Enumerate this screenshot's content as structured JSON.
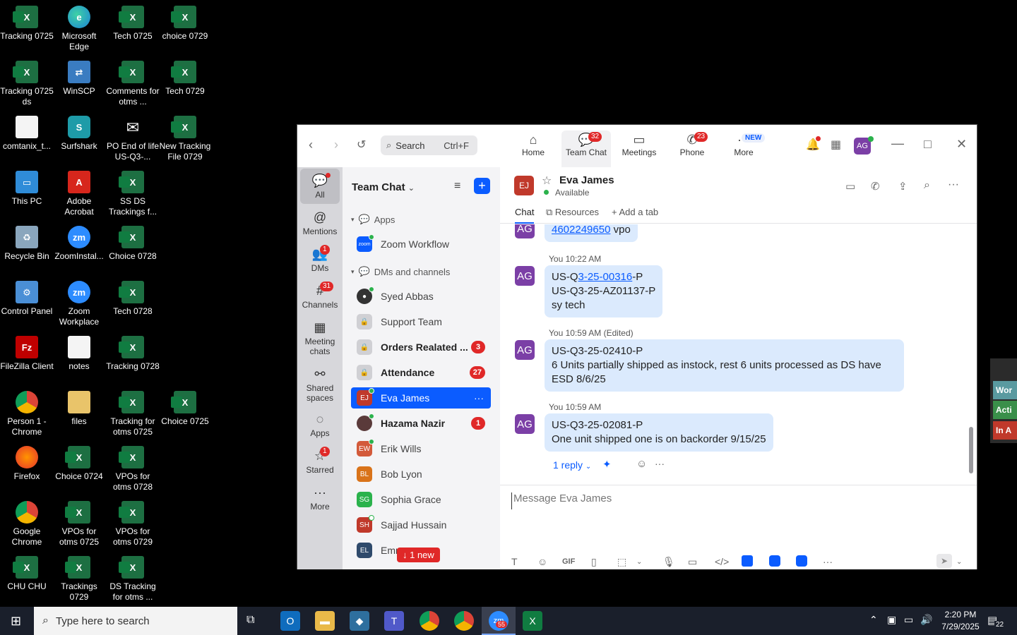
{
  "desktop": {
    "icons": [
      {
        "label": "Tracking 0725",
        "glyph": "X"
      },
      {
        "label": "Microsoft Edge",
        "glyph": "e"
      },
      {
        "label": "Tech 0725",
        "glyph": "X"
      },
      {
        "label": "choice 0729",
        "glyph": "X"
      },
      {
        "label": "Tracking 0725 ds",
        "glyph": "X"
      },
      {
        "label": "WinSCP",
        "glyph": "⇄"
      },
      {
        "label": "Comments for otms ...",
        "glyph": "X"
      },
      {
        "label": "Tech 0729",
        "glyph": "X"
      },
      {
        "label": "comtanix_t...",
        "glyph": ""
      },
      {
        "label": "Surfshark",
        "glyph": "S"
      },
      {
        "label": "PO End of life  US-Q3-...",
        "glyph": "✉"
      },
      {
        "label": "New Tracking File 0729",
        "glyph": "X"
      },
      {
        "label": "This PC",
        "glyph": "▭"
      },
      {
        "label": "Adobe Acrobat",
        "glyph": "A"
      },
      {
        "label": "SS DS Trackings f...",
        "glyph": "X"
      },
      {
        "label": "Recycle Bin",
        "glyph": "♻"
      },
      {
        "label": "ZoomInstal...",
        "glyph": "zm"
      },
      {
        "label": "Choice 0728",
        "glyph": "X"
      },
      {
        "label": "Control Panel",
        "glyph": "⚙"
      },
      {
        "label": "Zoom Workplace",
        "glyph": "zm"
      },
      {
        "label": "Tech 0728",
        "glyph": "X"
      },
      {
        "label": "FileZilla Client",
        "glyph": "Fz"
      },
      {
        "label": "notes",
        "glyph": ""
      },
      {
        "label": "Tracking 0728",
        "glyph": "X"
      },
      {
        "label": "Person 1 - Chrome",
        "glyph": ""
      },
      {
        "label": "files",
        "glyph": ""
      },
      {
        "label": "Tracking for otms 0725",
        "glyph": "X"
      },
      {
        "label": "Choice 0725",
        "glyph": "X"
      },
      {
        "label": "Firefox",
        "glyph": ""
      },
      {
        "label": "Choice 0724",
        "glyph": "X"
      },
      {
        "label": "VPOs for otms 0728",
        "glyph": "X"
      },
      {
        "label": "Google Chrome",
        "glyph": ""
      },
      {
        "label": "VPOs for otms 0725",
        "glyph": "X"
      },
      {
        "label": "VPOs for otms 0729",
        "glyph": "X"
      },
      {
        "label": "CHU CHU",
        "glyph": "X"
      },
      {
        "label": "Trackings 0729",
        "glyph": "X"
      },
      {
        "label": "DS Tracking for otms ...",
        "glyph": "X"
      }
    ]
  },
  "zoom": {
    "search": {
      "label": "Search",
      "shortcut": "Ctrl+F"
    },
    "nav": {
      "home": "Home",
      "team_chat": "Team Chat",
      "team_chat_badge": "32",
      "meetings": "Meetings",
      "phone": "Phone",
      "phone_badge": "23",
      "more": "More",
      "more_badge": "NEW"
    },
    "avatar_initials": "AG",
    "rail": {
      "all": "All",
      "mentions": "Mentions",
      "dms": "DMs",
      "dms_badge": "1",
      "channels": "Channels",
      "channels_badge": "31",
      "meeting_chats": "Meeting chats",
      "shared_spaces": "Shared spaces",
      "apps": "Apps",
      "starred": "Starred",
      "starred_badge": "1",
      "more": "More"
    },
    "sidebar": {
      "title": "Team Chat",
      "apps_section": "Apps",
      "zoom_workflow": "Zoom Workflow",
      "dms_section": "DMs and channels",
      "new_pill": "↓ 1 new",
      "items": [
        {
          "name": "Syed Abbas",
          "initials": "",
          "count": ""
        },
        {
          "name": "Support Team",
          "initials": "",
          "count": ""
        },
        {
          "name": "Orders Realated ...",
          "initials": "",
          "count": "3"
        },
        {
          "name": "Attendance",
          "initials": "",
          "count": "27"
        },
        {
          "name": "Eva James",
          "initials": "EJ",
          "count": ""
        },
        {
          "name": "Hazama Nazir",
          "initials": "",
          "count": "1"
        },
        {
          "name": "Erik Wills",
          "initials": "EW",
          "count": ""
        },
        {
          "name": "Bob Lyon",
          "initials": "BL",
          "count": ""
        },
        {
          "name": "Sophia Grace",
          "initials": "SG",
          "count": ""
        },
        {
          "name": "Sajjad Hussain",
          "initials": "SH",
          "count": ""
        },
        {
          "name": "Emm",
          "initials": "EL",
          "count": ""
        }
      ]
    },
    "chat": {
      "contact_initials": "EJ",
      "contact_name": "Eva James",
      "status": "Available",
      "tabs": {
        "chat": "Chat",
        "resources": "Resources",
        "add_tab": "Add a tab"
      },
      "messages": [
        {
          "meta": "",
          "initials": "AG",
          "lines": [
            "4602249650 vpo"
          ]
        },
        {
          "meta": "You 10:22 AM",
          "initials": "AG",
          "lines": [
            "US-Q3-25-00316-P",
            "US-Q3-25-AZ01137-P",
            "sy tech"
          ]
        },
        {
          "meta": "You 10:59 AM (Edited)",
          "initials": "AG",
          "lines": [
            "US-Q3-25-02410-P",
            "6 Units partially shipped as instock, rest 6 units processed as DS have ESD 8/6/25"
          ]
        },
        {
          "meta": "You 10:59 AM",
          "initials": "AG",
          "lines": [
            "US-Q3-25-02081-P",
            "One unit shipped one is on backorder 9/15/25"
          ]
        }
      ],
      "msg0_link": "4602249650",
      "msg0_rest": " vpo",
      "msg1_prefix": "US-Q",
      "msg1_link": "3-25-00316",
      "msg1_suffix": "-P",
      "reply": "1 reply",
      "composer_placeholder": "Message Eva James"
    }
  },
  "partial_window": {
    "btn1": "Wor",
    "btn2": "Acti",
    "btn3": "In A"
  },
  "taskbar": {
    "search_placeholder": "Type here to search",
    "zoom_badge": "55",
    "time": "2:20 PM",
    "date": "7/29/2025",
    "notifications": "22"
  },
  "colors": {
    "accent": "#0b5cff",
    "badge": "#e02828",
    "bubble": "#dbeafd",
    "avatar_ag": "#7b3fa6"
  }
}
